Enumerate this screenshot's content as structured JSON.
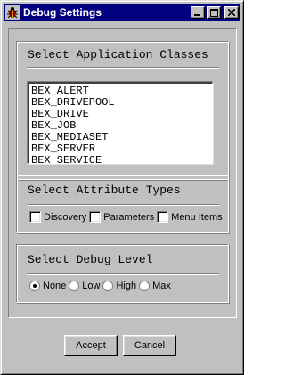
{
  "window": {
    "title": "Debug Settings",
    "app_icon": "bug-icon",
    "controls": [
      "minimize-icon",
      "maximize-icon",
      "close-icon"
    ]
  },
  "application_classes": {
    "heading": "Select Application Classes",
    "items": [
      "BEX_ALERT",
      "BEX_DRIVEPOOL",
      "BEX_DRIVE",
      "BEX_JOB",
      "BEX_MEDIASET",
      "BEX_SERVER",
      "BEX_SERVICE"
    ]
  },
  "attribute_types": {
    "heading": "Select Attribute Types",
    "options": [
      {
        "label": "Discovery",
        "checked": false
      },
      {
        "label": "Parameters",
        "checked": false
      },
      {
        "label": "Menu Items",
        "checked": false
      }
    ]
  },
  "debug_level": {
    "heading": "Select Debug Level",
    "options": [
      "None",
      "Low",
      "High",
      "Max"
    ],
    "selected": "None"
  },
  "buttons": {
    "accept": "Accept",
    "cancel": "Cancel"
  }
}
